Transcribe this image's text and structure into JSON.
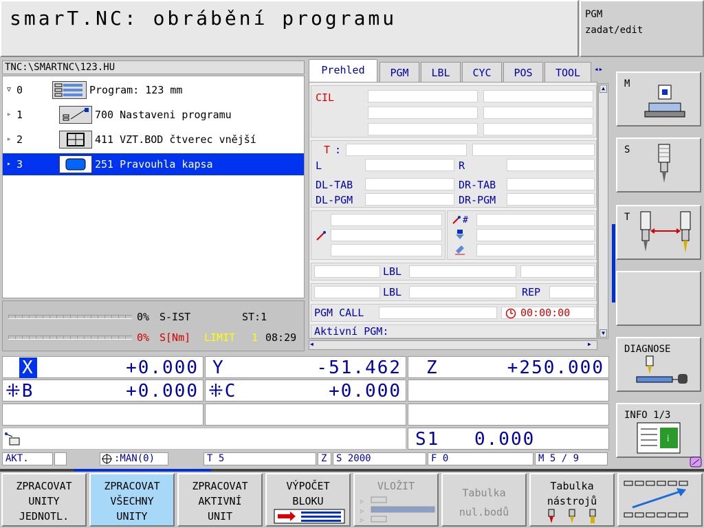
{
  "header": {
    "title": "smarT.NC: obrábění programu",
    "mode_line1": "PGM",
    "mode_line2": "zadat/edit"
  },
  "tree": {
    "path": "TNC:\\SMARTNC\\123.HU",
    "rows": [
      {
        "num": "0",
        "label": "Program: 123 mm"
      },
      {
        "num": "1",
        "label": "700 Nastaveni programu"
      },
      {
        "num": "2",
        "label": "411 VZT.BOD čtverec vnější"
      },
      {
        "num": "3",
        "label": "251 Pravouhla kapsa"
      }
    ]
  },
  "status": {
    "row1_pct": "0%",
    "row1_label": "S-IST",
    "st": "ST:1",
    "row2_pct": "0%",
    "row2_label": "S[Nm]",
    "limit": "LIMIT",
    "limit_val": "1",
    "time": "08:29"
  },
  "tabs": [
    "Prehled",
    "PGM",
    "LBL",
    "CYC",
    "POS",
    "TOOL"
  ],
  "overview": {
    "cil": "CIL",
    "t": "T",
    "t_colon": ":",
    "l": "L",
    "r": "R",
    "dl_tab": "DL-TAB",
    "dr_tab": "DR-TAB",
    "dl_pgm": "DL-PGM",
    "dr_pgm": "DR-PGM",
    "lbl1": "LBL",
    "lbl2": "LBL",
    "rep": "REP",
    "pgm_call": "PGM CALL",
    "timer": "00:00:00",
    "active_pgm": "Aktivní PGM:"
  },
  "side_softkeys": {
    "m": "M",
    "s": "S",
    "t": "T",
    "diagnose": "DIAGNOSE",
    "info": "INFO 1/3"
  },
  "positions": {
    "x_axis": "X",
    "x_val": "+0.000",
    "y_axis": "Y",
    "y_val": "-51.462",
    "z_axis": "Z",
    "z_val": "+250.000",
    "b_axis": "⁜B",
    "b_val": "+0.000",
    "c_axis": "⁜C",
    "c_val": "+0.000",
    "s1_label": "S1",
    "s1_val": "0.000"
  },
  "info_bar": {
    "akt": "AKT.",
    "man": ":MAN(0)",
    "t": "T 5",
    "z": "Z",
    "s": "S 2000",
    "f": "F 0",
    "m": "M 5 / 9"
  },
  "bottom_softkeys": [
    {
      "l1": "ZPRACOVAT",
      "l2": "UNITY",
      "l3": "JEDNOTL."
    },
    {
      "l1": "ZPRACOVAT",
      "l2": "VŠECHNY",
      "l3": "UNITY"
    },
    {
      "l1": "ZPRACOVAT",
      "l2": "AKTIVNÍ",
      "l3": "UNIT"
    },
    {
      "l1": "VÝPOČET",
      "l2": "BLOKU"
    },
    {
      "l1": "VLOŽIT"
    },
    {
      "l1": "Tabulka",
      "l2": "nul.bodů"
    },
    {
      "l1": "Tabulka",
      "l2": "nástrojů"
    }
  ],
  "colors": {
    "accent_blue": "#0000a8",
    "selection": "#0033ee",
    "alert_red": "#d40000",
    "limit_yellow": "#ffff00",
    "active_softkey": "#a8d8f8"
  }
}
